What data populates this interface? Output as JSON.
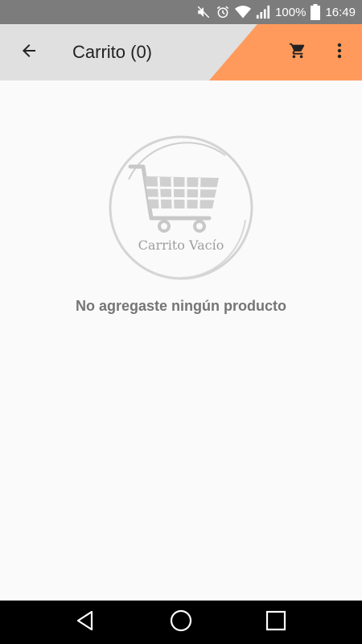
{
  "status_bar": {
    "battery": "100%",
    "time": "16:49",
    "icons": [
      "mute-icon",
      "alarm-icon",
      "wifi-icon",
      "signal-icon",
      "battery-icon"
    ]
  },
  "app_bar": {
    "title": "Carrito (0)",
    "accent_color": "#ff9a5c",
    "background_color": "#e0e0e0",
    "icons": [
      "back-arrow-icon",
      "cart-icon",
      "more-vert-icon"
    ]
  },
  "empty_state": {
    "illustration_label": "Carrito Vacío",
    "message": "No agregaste ningún producto"
  },
  "nav_bar": {
    "icons": [
      "back-triangle-icon",
      "home-circle-icon",
      "recents-square-icon"
    ]
  }
}
